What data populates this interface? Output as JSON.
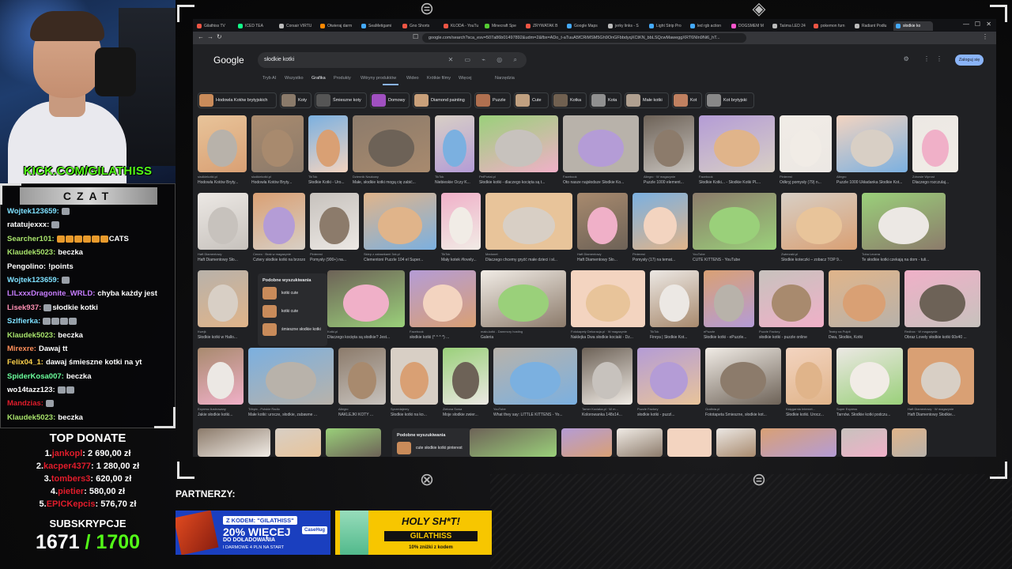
{
  "overlay": {
    "kick_url": "KICK.COM/GILATHISS",
    "chat_title": "CZAT",
    "chat_messages": [
      {
        "user": "Wojtek123659:",
        "color": "#7ee0ff",
        "text": "",
        "emotes": 1
      },
      {
        "user": "ratatujexxx:",
        "color": "#ffffff",
        "text": "",
        "emotes": 1
      },
      {
        "user": "Searcher101:",
        "color": "#a8e36b",
        "text": "CATS",
        "emotes": 6
      },
      {
        "user": "Klaudek5023:",
        "color": "#a8e36b",
        "text": "beczka",
        "emotes": 0
      },
      {
        "user": "Pengolino:",
        "color": "#ffffff",
        "text": "!points",
        "emotes": 0
      },
      {
        "user": "Wojtek123659:",
        "color": "#7ee0ff",
        "text": "",
        "emotes": 1
      },
      {
        "user": "LILxxxDragonite_WRLD:",
        "color": "#c77dff",
        "text": "chyba każdy jest",
        "emotes": 0
      },
      {
        "user": "Lisek937:",
        "color": "#ff8fb3",
        "text": "słodkie kotki",
        "emotes": 1
      },
      {
        "user": "Szlfierka:",
        "color": "#7ee0ff",
        "text": "",
        "emotes": 4
      },
      {
        "user": "Klaudek5023:",
        "color": "#a8e36b",
        "text": "beczka",
        "emotes": 0
      },
      {
        "user": "Mirexre:",
        "color": "#ff8f5a",
        "text": "Dawaj tt",
        "emotes": 0
      },
      {
        "user": "Felix04_1:",
        "color": "#ffd24a",
        "text": "dawaj śmieszne kotki na yt",
        "emotes": 0
      },
      {
        "user": "SpiderKosa007:",
        "color": "#6bff9c",
        "text": "beczka",
        "emotes": 0
      },
      {
        "user": "wo14tazz123:",
        "color": "#ffffff",
        "text": "",
        "emotes": 2
      },
      {
        "user": "Mandzias:",
        "color": "#e11c2b",
        "text": "",
        "emotes": 1
      },
      {
        "user": "Klaudek5023:",
        "color": "#a8e36b",
        "text": "beczka",
        "emotes": 0
      }
    ],
    "top_donate_title": "TOP DONATE",
    "top_donate": [
      {
        "rank": "1.",
        "name": "jankopl",
        "amount": ": 2 690,00 zł"
      },
      {
        "rank": "2.",
        "name": "kacper4377",
        "amount": ": 1 280,00 zł"
      },
      {
        "rank": "3.",
        "name": "tombers3",
        "amount": ": 620,00 zł"
      },
      {
        "rank": "4.",
        "name": "pietier",
        "amount": ": 580,00 zł"
      },
      {
        "rank": "5.",
        "name": "EPICKepcis",
        "amount": ": 576,70 zł"
      }
    ],
    "subs_title": "SUBSKRYPCJE",
    "subs_count": "1671",
    "subs_goal": " / 1700",
    "partners_label": "PARTNERZY:",
    "ad1": {
      "code": "Z KODEM: \"GILATHISS\"",
      "big": "20% WIĘCEJ",
      "sub": "DO DOŁADOWANIA",
      "sub2": "I DARMOWE 4 PLN NA START",
      "brand": "CaseHug"
    },
    "ad2": {
      "big": "HOLY SH*T!",
      "code": "GILATHISS",
      "sub": "10% zniżki z kodem"
    }
  },
  "browser": {
    "tabs": [
      "Gilathiss TV",
      "ICED TEA",
      "Corsair VIRTU",
      "Otwieraj darm",
      "SeaMetigami",
      "Gno Shorts",
      "KŁODA - YouTu",
      "Minecraft Spe",
      "ZRYWATAK B",
      "Google Maps",
      "jerky links - S",
      "Light Strip Pro",
      "led rgb action",
      "DOGSMEM M",
      "Taśma LED 24",
      "pokemon furn",
      "Radiant Podłu",
      "słodkie ko"
    ],
    "url": "google.com/search?sca_esv=507a86b01497892&udm=2&fbx=ADo_t-aTuuA5fCRiMSM5Gh9OnGFbbdyqXCtKN_bbLSQcwMaweggXRT6NIn9Ni6_hT...",
    "google_logo": "Google",
    "query": "słodkie kotki",
    "sign_in": "Zaloguj się",
    "search_tabs": [
      "Tryb AI",
      "Wszystko",
      "Grafika",
      "Produkty",
      "Witryny produktów",
      "Wideo",
      "Krótkie filmy",
      "Więcej",
      "Narzędzia"
    ],
    "active_tab_index": 2,
    "chips": [
      "Hodowla Kotów brytyjskich",
      "Koty",
      "Śmieszne koty",
      "Domowy",
      "Diamond painting",
      "Puzzle",
      "Cute",
      "Kotka",
      "Kota",
      "Małe kotki",
      "Kot",
      "Kot brytyjski"
    ],
    "related_title": "Podobne wyszukiwania",
    "related_items": [
      "kotki cute",
      "kotki cute",
      "śmieszne słodkie kotki"
    ],
    "related2_title": "Podobne wyszukiwania",
    "related2_item": "cute słodkie kotki pinterest",
    "rows": [
      [
        {
          "src": "sisdkiekotki.pl",
          "title": "Hodowla Kotów Bryty..."
        },
        {
          "src": "slodkiekotki.pl",
          "title": "Hodowla Kotów Bryty..."
        },
        {
          "src": "TikTok",
          "title": "Słodkie Kotki - Uro..."
        },
        {
          "src": "Dziennik Naukowy",
          "title": "Małe, słodkie kotki mogą cię zabić..."
        },
        {
          "src": "TikTok",
          "title": "Niebieskie Oczy K..."
        },
        {
          "src": "PetPortal.pl",
          "title": "Słodkie kotki - dlaczego kocięta są t..."
        },
        {
          "src": "Facebook",
          "title": "Oto nasze najsłodsze Słodkie Ko..."
        },
        {
          "src": "Allegro · W magazynie",
          "title": "Puzzle 1000 element..."
        },
        {
          "src": "Facebook",
          "title": "Słodkie Kotki... - Słodkie Kotki PL..."
        },
        {
          "src": "Pinterest",
          "title": "Odkryj pomysły (79) n..."
        },
        {
          "src": "Allegro",
          "title": "Puzzle 1000 Układanka Słodkie Kot..."
        },
        {
          "src": "Zdrowie Wprost",
          "title": "Dlaczego rozczulaj..."
        }
      ],
      [
        {
          "src": "Haft Diamentowy",
          "title": "Haft Diamentowy Sło..."
        },
        {
          "src": "Ceneo · Brak w magazynie",
          "title": "Cztery słodkie kotki na brzozowym..."
        },
        {
          "src": "Pinterest",
          "title": "Pomysły (900+) na..."
        },
        {
          "src": "Sklep z zabawkami 3xk.pl",
          "title": "Clementoni Puzzle 104 el Super..."
        },
        {
          "src": "TikTok",
          "title": "Mały kotek #lovely..."
        },
        {
          "src": "Medonet",
          "title": "Dlaczego chcemy gryźć małe dzieci i sł..."
        },
        {
          "src": "Haft Diamentowy",
          "title": "Haft Diamentowy Sło..."
        },
        {
          "src": "Pinterest",
          "title": "Pomysły (17) na temat..."
        },
        {
          "src": "YouTube",
          "title": "CUTE KITTENS - YouTube"
        },
        {
          "src": "Zwierzaki.pl",
          "title": "Słodkie koteczki – zobacz TOP 9..."
        },
        {
          "src": "Tuba Leczna",
          "title": "Te słodkie kotki czekają na dom - tuli..."
        }
      ],
      [
        {
          "src": "Kwejk",
          "title": "Słodkie kotki w Hallo..."
        },
        {
          "src": "Kotki.pl",
          "title": "Dlaczego kocięta są słodkie? Jest..."
        },
        {
          "src": "Facebook",
          "title": "słodkie kotki (* ^ ^ *) ..."
        },
        {
          "src": "mało-kotki - Dammory hosting",
          "title": "Galeria"
        },
        {
          "src": "Fotokapety Dekoracja.pl · W magazynie",
          "title": "Naklejka Dwa słodkie kociaki - Dz..."
        },
        {
          "src": "TikTok",
          "title": "Fireya | Słodkie Kot..."
        },
        {
          "src": "ePuzzle",
          "title": "Słodkie kotki - ePuzzle..."
        },
        {
          "src": "Puzzle Factory",
          "title": "słodkie kotki - puzzle online"
        },
        {
          "src": "Teatry na Pulpit",
          "title": "Dwa, Słodkie, Kotki"
        },
        {
          "src": "Redbox · W magazynie",
          "title": "Obraz Lovely słodkie kotki 60x40 ..."
        }
      ],
      [
        {
          "src": "Express Ilustrowany",
          "title": "Jakie słodkie kotki..."
        },
        {
          "src": "Tribpix - Polskie Radio",
          "title": "Małe kotki: urocze, słodkie, zabawne ..."
        },
        {
          "src": "Allegro",
          "title": "NAKLEJKI KOTY ..."
        },
        {
          "src": "Sprzedajemy",
          "title": "Słodkie kotki na ko..."
        },
        {
          "src": "Zielona Sowa",
          "title": "Moje słodkie zwier..."
        },
        {
          "src": "YouTube",
          "title": "What they say: LITTLE KITTENS - Yo..."
        },
        {
          "src": "Tamer Kociaka.pl · W m...",
          "title": "Kolorowanka 148x14..."
        },
        {
          "src": "Puzzle Factory",
          "title": "słodkie kotki - puzzl..."
        },
        {
          "src": "Grafinia.pl",
          "title": "Fototapeta Śmieszne, słodkie kot..."
        },
        {
          "src": "Księgarnia Internet...",
          "title": "Słodkie kotki. Urocz..."
        },
        {
          "src": "Super Express",
          "title": "Tarnów. Słodkie kotki podczu..."
        },
        {
          "src": "Haft Diamentowy · W magazynie",
          "title": "Haft Diamentowy Słodkie..."
        }
      ]
    ]
  },
  "colors": {
    "kick_green": "#53fc18",
    "donate_red": "#e11c2b",
    "google_blue": "#8ab4f8"
  }
}
